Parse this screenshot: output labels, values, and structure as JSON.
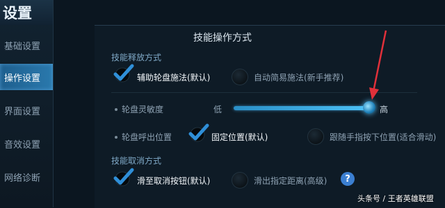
{
  "sidebar": {
    "title": "设置",
    "items": [
      {
        "label": "基础设置",
        "active": false
      },
      {
        "label": "操作设置",
        "active": true
      },
      {
        "label": "界面设置",
        "active": false
      },
      {
        "label": "音效设置",
        "active": false
      },
      {
        "label": "网络诊断",
        "active": false
      }
    ]
  },
  "panel": {
    "title": "技能操作方式",
    "skill_release": {
      "section_label": "技能释放方式",
      "option_selected": "辅助轮盘施法(默认)",
      "option_other": "自动简易施法(新手推荐)"
    },
    "sensitivity": {
      "label": "轮盘灵敏度",
      "low": "低",
      "high": "高",
      "level_fraction": 0.98
    },
    "wheel_position": {
      "label": "轮盘呼出位置",
      "option_selected": "固定位置(默认)",
      "option_other": "跟随手指按下位置(适合滑动)"
    },
    "skill_cancel": {
      "section_label": "技能取消方式",
      "option_selected": "滑至取消按钮(默认)",
      "option_other": "滑出指定距离(高级)",
      "help": "?"
    }
  },
  "watermark": "头条号 / 王者英雄联盟",
  "colors": {
    "accent": "#2a8fc7",
    "active_tab": "#2a79ad",
    "check": "#2f8fd8",
    "arrow": "#e0303a"
  }
}
